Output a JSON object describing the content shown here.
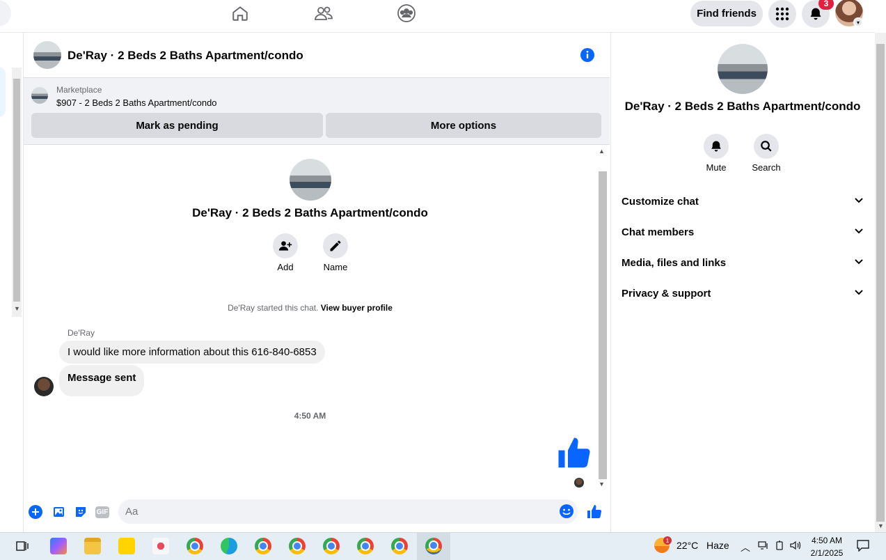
{
  "header": {
    "find_friends_label": "Find friends",
    "notification_count": "3"
  },
  "chat": {
    "title": "De'Ray · 2 Beds 2 Baths Apartment/condo",
    "marketplace_label": "Marketplace",
    "listing_line": "$907 - 2 Beds 2 Baths Apartment/condo",
    "mark_pending_label": "Mark as pending",
    "more_options_label": "More options",
    "add_label": "Add",
    "name_label": "Name",
    "started_text": "De'Ray started this chat.",
    "view_buyer_profile": "View buyer profile",
    "sender_name": "De'Ray",
    "messages": [
      "I would like more information about this 616-840-6853",
      "Message sent"
    ],
    "timestamp": "4:50 AM",
    "composer_placeholder": "Aa",
    "gif_label": "GIF"
  },
  "panel": {
    "title": "De'Ray · 2 Beds 2 Baths Apartment/condo",
    "mute_label": "Mute",
    "search_label": "Search",
    "sections": [
      "Customize chat",
      "Chat members",
      "Media, files and links",
      "Privacy & support"
    ]
  },
  "taskbar": {
    "weather_temp": "22°C",
    "weather_cond": "Haze",
    "weather_alert": "1",
    "time": "4:50 AM",
    "date": "2/1/2025"
  },
  "colors": {
    "accent": "#0866ff",
    "badge": "#e41e3f",
    "button_bg": "#e4e6eb"
  }
}
